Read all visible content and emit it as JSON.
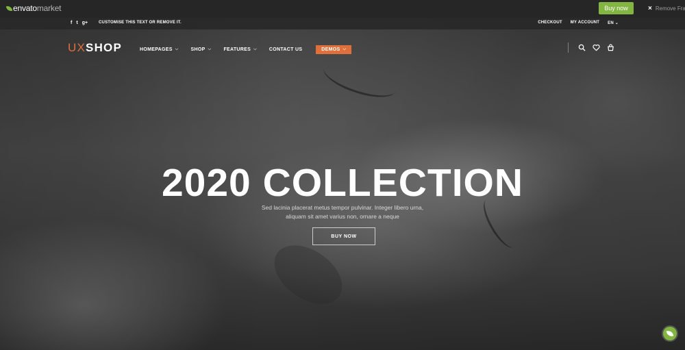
{
  "envato": {
    "logo_brand": "envato",
    "logo_suffix": "market",
    "buy_now": "Buy now",
    "remove_frame": "Remove Frame"
  },
  "topbar": {
    "social": [
      "f",
      "t",
      "g+"
    ],
    "tagline": "CUSTOMISE THIS TEXT OR REMOVE IT.",
    "checkout": "CHECKOUT",
    "my_account": "MY ACCOUNT",
    "language": "EN"
  },
  "header": {
    "logo_ux": "UX",
    "logo_shop": "SHOP",
    "nav": [
      {
        "label": "HOMEPAGES",
        "dropdown": true
      },
      {
        "label": "SHOP",
        "dropdown": true
      },
      {
        "label": "FEATURES",
        "dropdown": true
      },
      {
        "label": "CONTACT US",
        "dropdown": false
      }
    ],
    "demos": "DEMOS",
    "icons": [
      "search-icon",
      "heart-icon",
      "cart-icon"
    ]
  },
  "hero": {
    "title": "2020 COLLECTION",
    "subtitle_line1": "Sed lacinia placerat metus tempor pulvinar. Integer libero urna,",
    "subtitle_line2": "aliquam sit amet varius non, ornare a neque",
    "button": "BUY NOW"
  },
  "colors": {
    "accent": "#e0703b",
    "envato_green": "#82b541",
    "bar_dark": "#262626"
  }
}
